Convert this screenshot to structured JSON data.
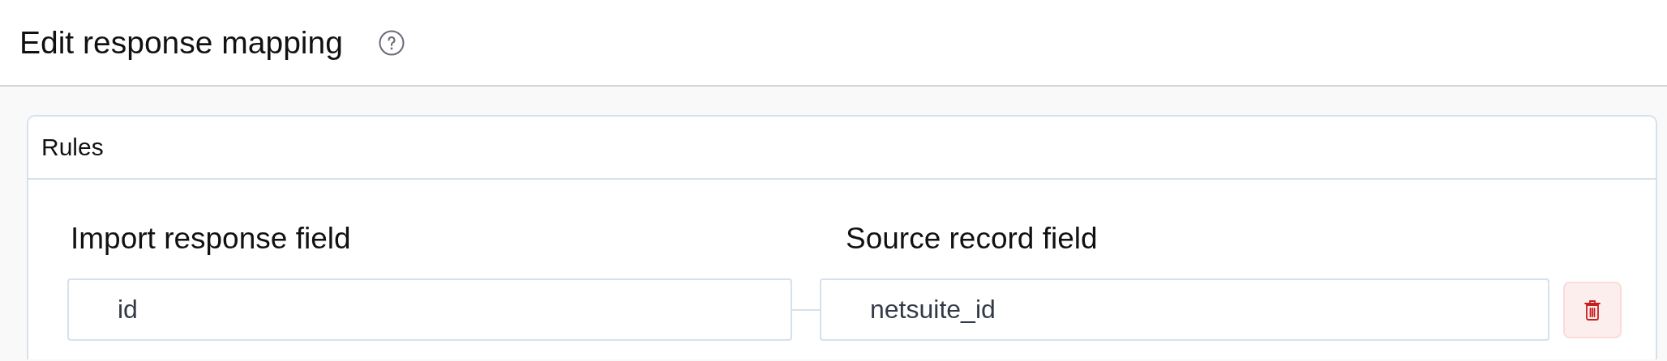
{
  "header": {
    "title": "Edit response mapping"
  },
  "panel": {
    "title": "Rules",
    "columns": [
      "Import response field",
      "Source record field"
    ],
    "rows": [
      {
        "import_field": "id",
        "source_field": "netsuite_id"
      }
    ]
  }
}
